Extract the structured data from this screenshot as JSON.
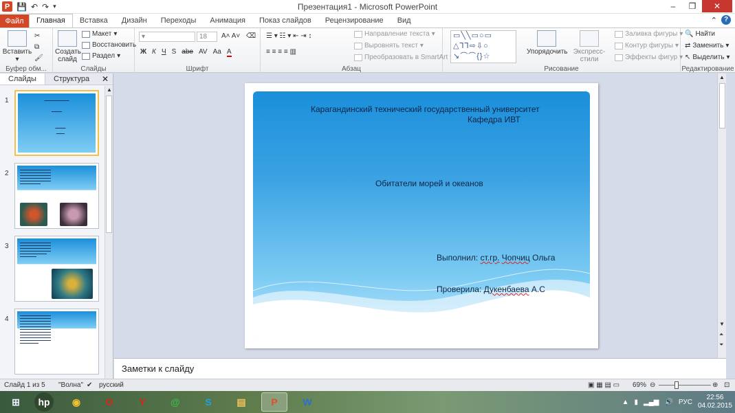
{
  "window": {
    "title": "Презентация1 - Microsoft PowerPoint",
    "app_logo": "P",
    "minimize": "–",
    "maximize": "❐",
    "close": "✕"
  },
  "tabs": [
    "Файл",
    "Главная",
    "Вставка",
    "Дизайн",
    "Переходы",
    "Анимация",
    "Показ слайдов",
    "Рецензирование",
    "Вид"
  ],
  "ribbon": {
    "groups": {
      "clipboard": "Буфер обм...",
      "slides": "Слайды",
      "font": "Шрифт",
      "paragraph": "Абзац",
      "drawing": "Рисование",
      "editing": "Редактирование"
    },
    "paste": "Вставить",
    "new_slide": "Создать слайд",
    "layout": "Макет",
    "reset": "Восстановить",
    "section": "Раздел",
    "font_size": "18",
    "font_buttons": [
      "Ж",
      "К",
      "Ч",
      "S",
      "abe",
      "AV",
      "Aa",
      "A"
    ],
    "text_direction": "Направление текста",
    "align_text": "Выровнять текст",
    "smartart": "Преобразовать в SmartArt",
    "arrange": "Упорядочить",
    "quick_styles": "Экспресс-стили",
    "shape_fill": "Заливка фигуры",
    "shape_outline": "Контур фигуры",
    "shape_effects": "Эффекты фигур",
    "find": "Найти",
    "replace": "Заменить",
    "select": "Выделить"
  },
  "left_pane": {
    "tab_slides": "Слайды",
    "tab_outline": "Структура",
    "close": "✕",
    "slide_numbers": [
      "1",
      "2",
      "3",
      "4"
    ]
  },
  "slide": {
    "line1": "Карагандинский технический государственный университет",
    "line2": "Кафедра ИВТ",
    "title": "Обитатели морей и океанов",
    "author_label": "Выполнил:",
    "author_group": "ст.гр.",
    "author_name_first": "Чопчиц",
    "author_name_last": "Ольга",
    "checker_label": "Проверила:",
    "checker_name": "Дукенбаева",
    "checker_initials": "А.С"
  },
  "notes": {
    "placeholder": "Заметки к слайду"
  },
  "statusbar": {
    "slide_info": "Слайд 1 из 5",
    "theme": "\"Волна\"",
    "language": "русский",
    "zoom": "69%"
  },
  "taskbar": {
    "language": "РУС",
    "time": "22:56",
    "date": "04.02.2015"
  },
  "colors": {
    "accent": "#d24726",
    "slide_blue": "#1b8fdb"
  }
}
